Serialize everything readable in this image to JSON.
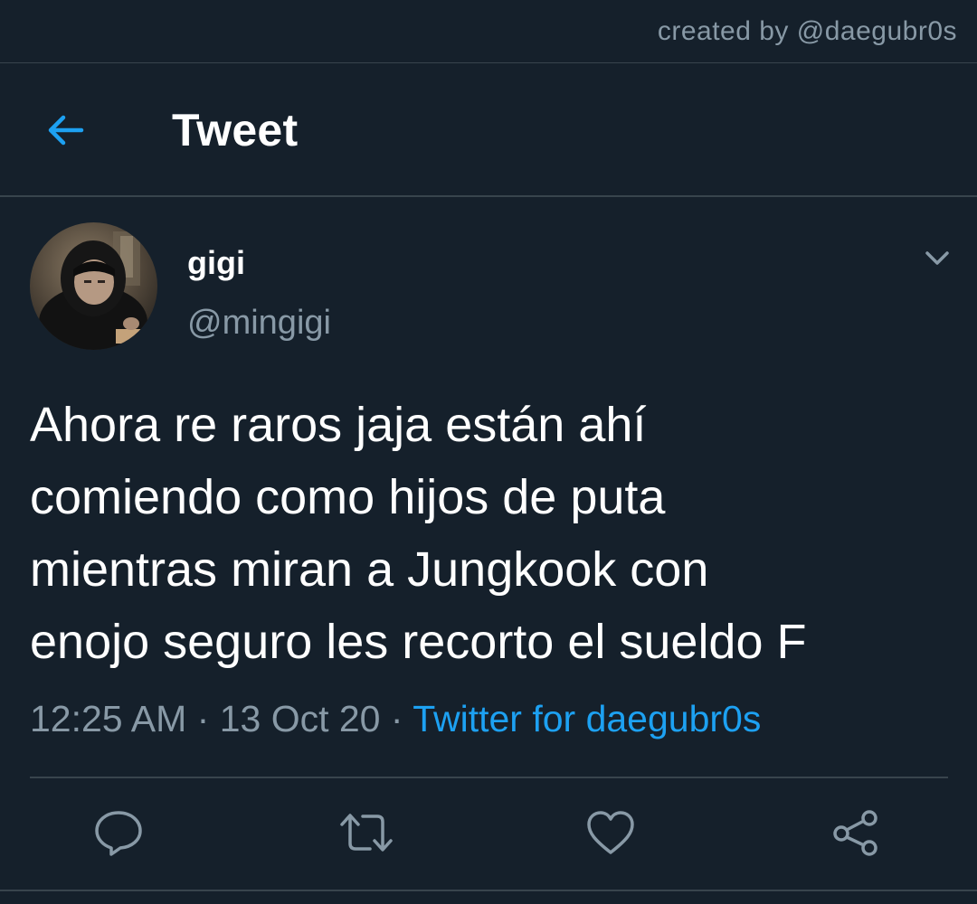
{
  "watermark": "created by @daegubr0s",
  "header": {
    "title": "Tweet",
    "back_icon": "back-arrow-icon",
    "accent_color": "#1da1f2"
  },
  "tweet": {
    "author": {
      "display_name": "gigi",
      "handle": "@mingigi"
    },
    "text_lines": [
      "Ahora re raros jaja están ahí",
      "comiendo como hijos de puta",
      "mientras miran a Jungkook con",
      "enojo seguro les recorto el sueldo F"
    ],
    "time": "12:25 AM",
    "date": "13 Oct 20",
    "separator": "·",
    "source": "Twitter for daegubr0s"
  },
  "actions": [
    {
      "name": "reply-button",
      "icon": "reply-icon"
    },
    {
      "name": "retweet-button",
      "icon": "retweet-icon"
    },
    {
      "name": "like-button",
      "icon": "heart-icon"
    },
    {
      "name": "share-button",
      "icon": "share-icon"
    }
  ],
  "colors": {
    "background": "#15202b",
    "divider": "#38444d",
    "secondary_text": "#8899a6",
    "link": "#1da1f2"
  }
}
